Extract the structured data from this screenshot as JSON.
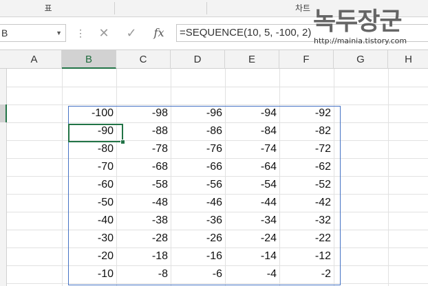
{
  "ribbon": {
    "group_1": "표",
    "group_2": "차트"
  },
  "formula_bar": {
    "name_box_value": "B",
    "cancel_icon": "x-icon",
    "enter_icon": "check-icon",
    "fx_label": "fx",
    "formula": "=SEQUENCE(10, 5, -100, 2)"
  },
  "watermark": {
    "logo_text": "녹두장군",
    "url": "http://mainia.tistory.com"
  },
  "columns": [
    "A",
    "B",
    "C",
    "D",
    "E",
    "F",
    "G",
    "H"
  ],
  "active_column": "B",
  "cells": {
    "rows": [
      [
        "-100",
        "-98",
        "-96",
        "-94",
        "-92"
      ],
      [
        "-90",
        "-88",
        "-86",
        "-84",
        "-82"
      ],
      [
        "-80",
        "-78",
        "-76",
        "-74",
        "-72"
      ],
      [
        "-70",
        "-68",
        "-66",
        "-64",
        "-62"
      ],
      [
        "-60",
        "-58",
        "-56",
        "-54",
        "-52"
      ],
      [
        "-50",
        "-48",
        "-46",
        "-44",
        "-42"
      ],
      [
        "-40",
        "-38",
        "-36",
        "-34",
        "-32"
      ],
      [
        "-30",
        "-28",
        "-26",
        "-24",
        "-22"
      ],
      [
        "-20",
        "-18",
        "-16",
        "-14",
        "-12"
      ],
      [
        "-10",
        "-8",
        "-6",
        "-4",
        "-2"
      ]
    ]
  },
  "colors": {
    "accent_green": "#217346",
    "range_border": "#4472c4"
  }
}
